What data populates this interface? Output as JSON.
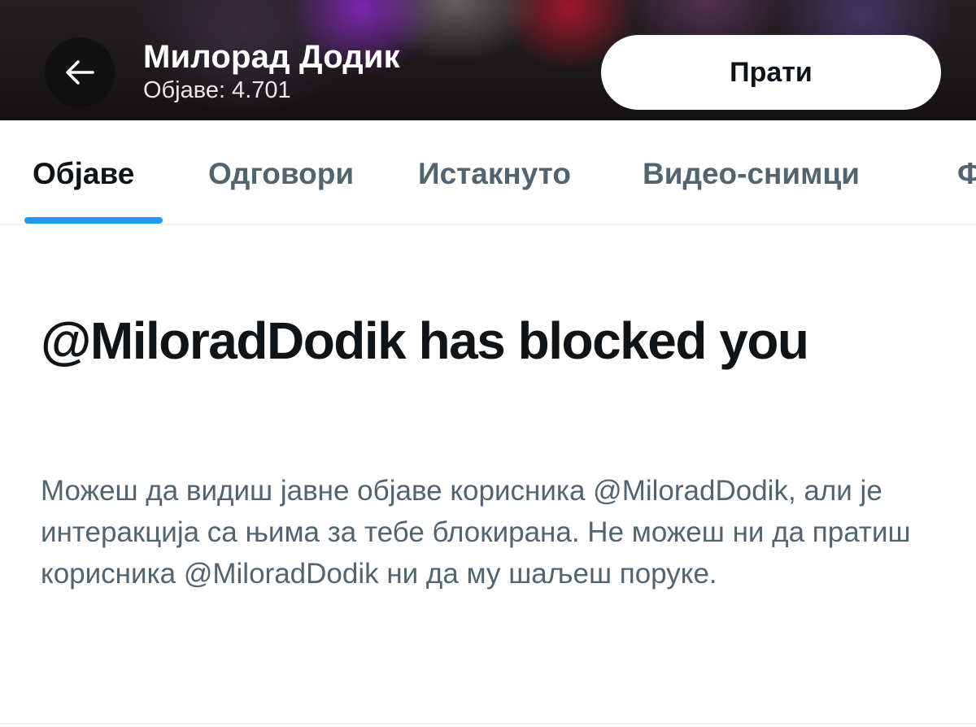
{
  "header": {
    "name": "Милорад Додик",
    "post_count": "Објаве: 4.701",
    "follow_label": "Прати",
    "back_icon": "arrow-left-icon"
  },
  "tabs": [
    {
      "label": "Објаве",
      "active": true
    },
    {
      "label": "Одговори",
      "active": false
    },
    {
      "label": "Истакнуто",
      "active": false
    },
    {
      "label": "Видео-снимци",
      "active": false
    },
    {
      "label": "Ф",
      "active": false
    }
  ],
  "blocked": {
    "title": "@MiloradDodik has blocked you",
    "body": "Можеш да видиш јавне објаве корисника @MiloradDodik,  али је интеракција са њима за тебе блокирана. Не можеш ни да пратиш корисника @MiloradDodik ни да му шаљеш поруке."
  },
  "colors": {
    "primary_text": "#0f1419",
    "secondary_text": "#536471",
    "accent": "#1d9bf0",
    "divider": "#eff3f4"
  }
}
